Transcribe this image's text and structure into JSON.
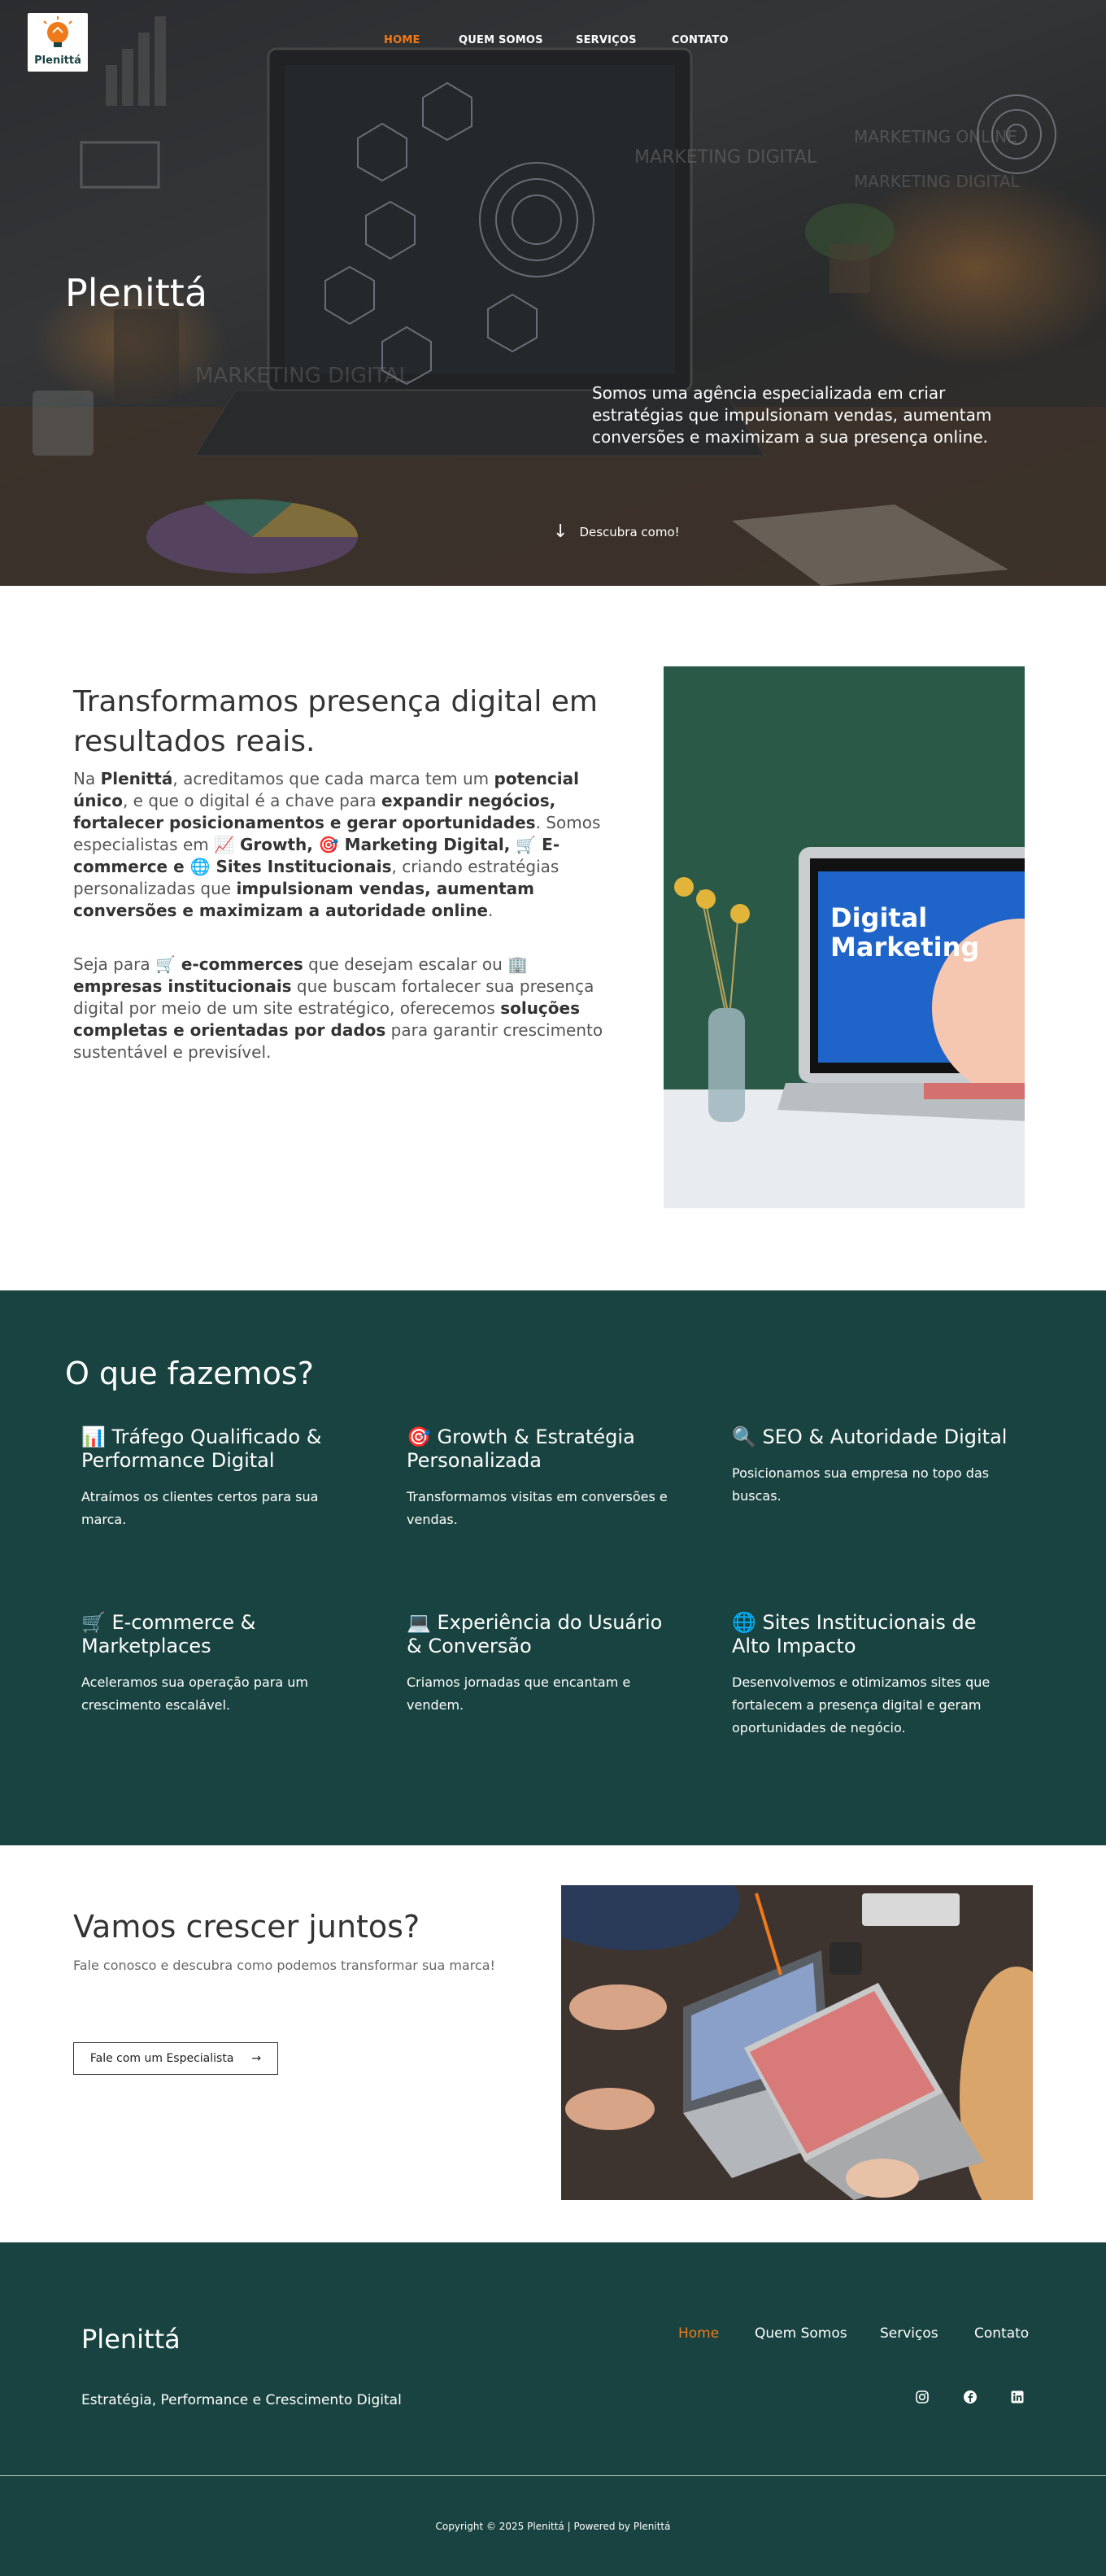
{
  "header": {
    "logo_text": "Plenittá",
    "nav": [
      {
        "label": "HOME",
        "active": true
      },
      {
        "label": "QUEM SOMOS",
        "active": false
      },
      {
        "label": "SERVIÇOS",
        "active": false
      },
      {
        "label": "CONTATO",
        "active": false
      }
    ]
  },
  "hero": {
    "title": "Plenittá",
    "description": "Somos uma agência especializada em criar estratégias que impulsionam vendas, aumentam conversões e maximizam a sua presença online.",
    "cta_label": "Descubra como!",
    "bg_texts": [
      "MARKETING DIGITAL",
      "MARKETING ONLINE",
      "MARKETING DIGITAL",
      "MARKETING DIGITAL"
    ]
  },
  "about": {
    "title": "Transformamos presença digital em resultados reais.",
    "p1": [
      {
        "t": "Na ",
        "b": false
      },
      {
        "t": "Plenittá",
        "b": true
      },
      {
        "t": ", acreditamos que cada marca tem um ",
        "b": false
      },
      {
        "t": "potencial único",
        "b": true
      },
      {
        "t": ", e que o digital é a chave para ",
        "b": false
      },
      {
        "t": "expandir negócios, fortalecer posicionamentos e gerar oportunidades",
        "b": true
      },
      {
        "t": ". Somos especialistas em ",
        "b": false
      },
      {
        "t": "📈 Growth, 🎯 Marketing Digital, 🛒 E-commerce e 🌐 Sites Institucionais",
        "b": true
      },
      {
        "t": ", criando estratégias personalizadas que ",
        "b": false
      },
      {
        "t": "impulsionam vendas, aumentam conversões e maximizam a autoridade online",
        "b": true
      },
      {
        "t": ".",
        "b": false
      }
    ],
    "p2": [
      {
        "t": "Seja para ",
        "b": false
      },
      {
        "t": "🛒 e-commerces",
        "b": true
      },
      {
        "t": " que desejam escalar ou ",
        "b": false
      },
      {
        "t": "🏢 empresas institucionais",
        "b": true
      },
      {
        "t": " que buscam fortalecer sua presença digital por meio de um site estratégico, oferecemos ",
        "b": false
      },
      {
        "t": "soluções completas e orientadas por dados",
        "b": true
      },
      {
        "t": " para garantir crescimento sustentável e previsível.",
        "b": false
      }
    ],
    "image_text": "Digital Marketing"
  },
  "services": {
    "title": "O que fazemos?",
    "items": [
      {
        "title": "📊 Tráfego Qualificado & Performance Digital",
        "desc": "Atraímos os clientes certos para sua marca."
      },
      {
        "title": "🎯 Growth & Estratégia Personalizada",
        "desc": "Transformamos visitas em conversões e vendas."
      },
      {
        "title": "🔍 SEO & Autoridade Digital",
        "desc": "Posicionamos sua empresa no topo das buscas."
      },
      {
        "title": "🛒 E-commerce & Marketplaces",
        "desc": "Aceleramos sua operação para um crescimento escalável."
      },
      {
        "title": "💻 Experiência do Usuário & Conversão",
        "desc": "Criamos jornadas que encantam e vendem."
      },
      {
        "title": "🌐 Sites Institucionais de Alto Impacto",
        "desc": "Desenvolvemos e otimizamos sites que fortalecem a presença digital e geram oportunidades de negócio."
      }
    ]
  },
  "cta": {
    "title": "Vamos crescer juntos?",
    "subtitle": "Fale conosco e descubra como podemos transformar sua marca!",
    "button_label": "Fale com um Especialista"
  },
  "footer": {
    "brand": "Plenittá",
    "tagline": "Estratégia, Performance e Crescimento Digital",
    "nav": [
      {
        "label": "Home",
        "active": true
      },
      {
        "label": "Quem Somos",
        "active": false
      },
      {
        "label": "Serviços",
        "active": false
      },
      {
        "label": "Contato",
        "active": false
      }
    ],
    "social_icons": [
      "instagram-icon",
      "facebook-icon",
      "linkedin-icon"
    ],
    "copyright": "Copyright © 2025 Plenittá | Powered by Plenittá"
  },
  "colors": {
    "accent_orange": "#ef7a1a",
    "dark_green": "#184340",
    "text_dark": "#333333"
  }
}
